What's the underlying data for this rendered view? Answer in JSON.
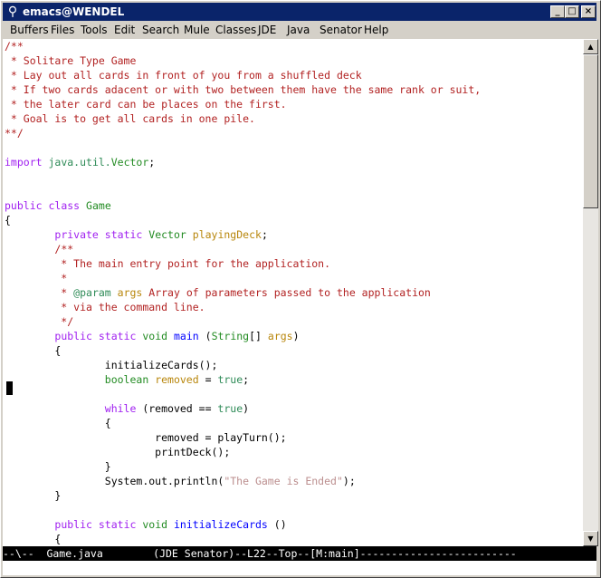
{
  "window": {
    "title": "emacs@WENDEL",
    "minimize": "_",
    "maximize": "□",
    "close": "×"
  },
  "menu": [
    "Buffers",
    "Files",
    "Tools",
    "Edit",
    "Search",
    "Mule",
    "Classes",
    "JDE",
    "Java",
    "Senator",
    "Help"
  ],
  "code_lines": [
    [
      {
        "t": "/**",
        "c": "c"
      }
    ],
    [
      {
        "t": " * Solitare Type Game",
        "c": "c"
      }
    ],
    [
      {
        "t": " * Lay out all cards in front of you from a shuffled deck",
        "c": "c"
      }
    ],
    [
      {
        "t": " * If two cards adacent or with two between them have the same rank or suit,",
        "c": "c"
      }
    ],
    [
      {
        "t": " * the later card can be places on the first.",
        "c": "c"
      }
    ],
    [
      {
        "t": " * Goal is to get all cards in one pile.",
        "c": "c"
      }
    ],
    [
      {
        "t": "**/",
        "c": "c"
      }
    ],
    [],
    [
      {
        "t": "import",
        "c": "k"
      },
      {
        "t": " "
      },
      {
        "t": "java.util.",
        "c": "p"
      },
      {
        "t": "Vector",
        "c": "t"
      },
      {
        "t": ";"
      }
    ],
    [],
    [],
    [
      {
        "t": "public",
        "c": "k"
      },
      {
        "t": " "
      },
      {
        "t": "class",
        "c": "k"
      },
      {
        "t": " "
      },
      {
        "t": "Game",
        "c": "t"
      }
    ],
    [
      {
        "t": "{"
      }
    ],
    [
      {
        "t": "        "
      },
      {
        "t": "private",
        "c": "k"
      },
      {
        "t": " "
      },
      {
        "t": "static",
        "c": "k"
      },
      {
        "t": " "
      },
      {
        "t": "Vector",
        "c": "t"
      },
      {
        "t": " "
      },
      {
        "t": "playingDeck",
        "c": "v"
      },
      {
        "t": ";"
      }
    ],
    [
      {
        "t": "        "
      },
      {
        "t": "/**",
        "c": "c"
      }
    ],
    [
      {
        "t": "         * The main entry point for the application.",
        "c": "c"
      }
    ],
    [
      {
        "t": "         *",
        "c": "c"
      }
    ],
    [
      {
        "t": "         * ",
        "c": "c"
      },
      {
        "t": "@param",
        "c": "p"
      },
      {
        "t": " "
      },
      {
        "t": "args",
        "c": "v"
      },
      {
        "t": " Array of parameters passed to the application",
        "c": "c"
      }
    ],
    [
      {
        "t": "         * via the command line.",
        "c": "c"
      }
    ],
    [
      {
        "t": "         */",
        "c": "c"
      }
    ],
    [
      {
        "t": "        "
      },
      {
        "t": "public",
        "c": "k"
      },
      {
        "t": " "
      },
      {
        "t": "static",
        "c": "k"
      },
      {
        "t": " "
      },
      {
        "t": "void",
        "c": "t"
      },
      {
        "t": " "
      },
      {
        "t": "main",
        "c": "f"
      },
      {
        "t": " ("
      },
      {
        "t": "String",
        "c": "t"
      },
      {
        "t": "[] "
      },
      {
        "t": "args",
        "c": "v"
      },
      {
        "t": ")"
      }
    ],
    [
      {
        "t": "        {"
      }
    ],
    [
      {
        "t": "                initializeCards();"
      }
    ],
    [
      {
        "t": "                "
      },
      {
        "t": "boolean",
        "c": "t"
      },
      {
        "t": " "
      },
      {
        "t": "removed",
        "c": "v"
      },
      {
        "t": " = "
      },
      {
        "t": "true",
        "c": "p"
      },
      {
        "t": ";"
      }
    ],
    [],
    [
      {
        "t": "                "
      },
      {
        "t": "while",
        "c": "k"
      },
      {
        "t": " (removed == "
      },
      {
        "t": "true",
        "c": "p"
      },
      {
        "t": ")"
      }
    ],
    [
      {
        "t": "                {"
      }
    ],
    [
      {
        "t": "                        removed = playTurn();"
      }
    ],
    [
      {
        "t": "                        printDeck();"
      }
    ],
    [
      {
        "t": "                }"
      }
    ],
    [
      {
        "t": "                System.out.println("
      },
      {
        "t": "\"The Game is Ended\"",
        "c": "s"
      },
      {
        "t": ");"
      }
    ],
    [
      {
        "t": "        }"
      }
    ],
    [],
    [
      {
        "t": "        "
      },
      {
        "t": "public",
        "c": "k"
      },
      {
        "t": " "
      },
      {
        "t": "static",
        "c": "k"
      },
      {
        "t": " "
      },
      {
        "t": "void",
        "c": "t"
      },
      {
        "t": " "
      },
      {
        "t": "initializeCards",
        "c": "f"
      },
      {
        "t": " ()"
      }
    ],
    [
      {
        "t": "        {"
      }
    ]
  ],
  "modeline": "--\\--  Game.java        (JDE Senator)--L22--Top--[M:main]-------------------------"
}
